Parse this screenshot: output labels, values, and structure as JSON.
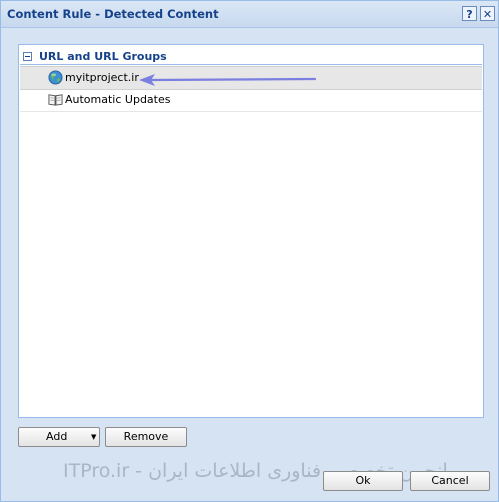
{
  "dialog": {
    "title": "Content Rule - Detected Content",
    "help_glyph": "?",
    "close_glyph": "✕"
  },
  "tree": {
    "group_label": "URL and URL Groups",
    "items": [
      {
        "label": "myitproject.ir",
        "icon": "globe-icon",
        "selected": true
      },
      {
        "label": "Automatic Updates",
        "icon": "book-icon",
        "selected": false
      }
    ]
  },
  "buttons": {
    "add": "Add",
    "add_caret": "▼",
    "remove": "Remove",
    "ok": "Ok",
    "cancel": "Cancel"
  },
  "watermark": "ITPro.ir - انجمن تخصصی فناوری اطلاعات ایران",
  "colors": {
    "title_text": "#15428b",
    "dialog_bg": "#d6e3f2",
    "border": "#99bbe8",
    "arrow": "#7b7fe0",
    "selected_row": "#e7e7e7"
  }
}
